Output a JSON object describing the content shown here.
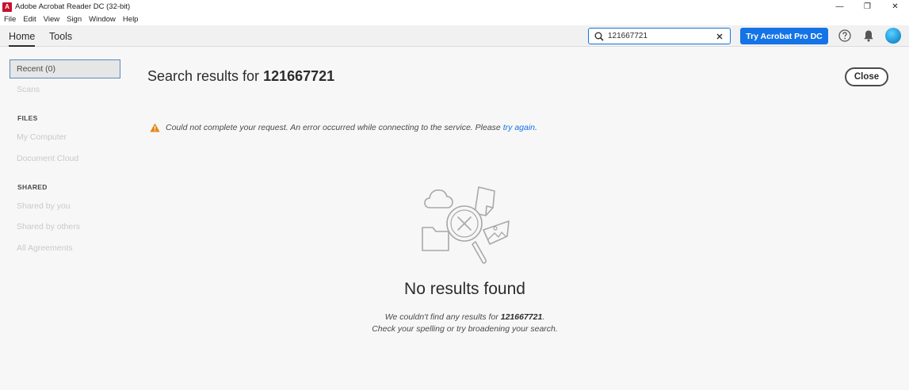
{
  "window": {
    "title": "Adobe Acrobat Reader DC (32-bit)",
    "logo_letter": "A",
    "minimize": "—",
    "restore": "❐",
    "close": "✕"
  },
  "menu": [
    "File",
    "Edit",
    "View",
    "Sign",
    "Window",
    "Help"
  ],
  "topnav": {
    "tabs": [
      {
        "label": "Home",
        "active": true
      },
      {
        "label": "Tools",
        "active": false
      }
    ],
    "search": {
      "value": "121667721"
    },
    "try_button": "Try Acrobat Pro DC",
    "icons": [
      "help-icon",
      "bell-icon",
      "avatar"
    ],
    "accent": "#1473e6"
  },
  "sidebar": {
    "recent": "Recent (0)",
    "scans": "Scans",
    "files_heading": "FILES",
    "my_computer": "My Computer",
    "document_cloud": "Document Cloud",
    "shared_heading": "SHARED",
    "shared_by_you": "Shared by you",
    "shared_by_others": "Shared by others",
    "all_agreements": "All Agreements"
  },
  "main": {
    "title_prefix": "Search results for",
    "query": "121667721",
    "close_button": "Close",
    "error_text": "Could not complete your request. An error occurred while connecting to the service. Please",
    "error_link": "try again",
    "error_end": ".",
    "no_results": "No results found",
    "sub1_prefix": "We couldn't find any results for",
    "sub1_query": "121667721",
    "sub1_end": ".",
    "sub2": "Check your spelling or try broadening your search."
  }
}
